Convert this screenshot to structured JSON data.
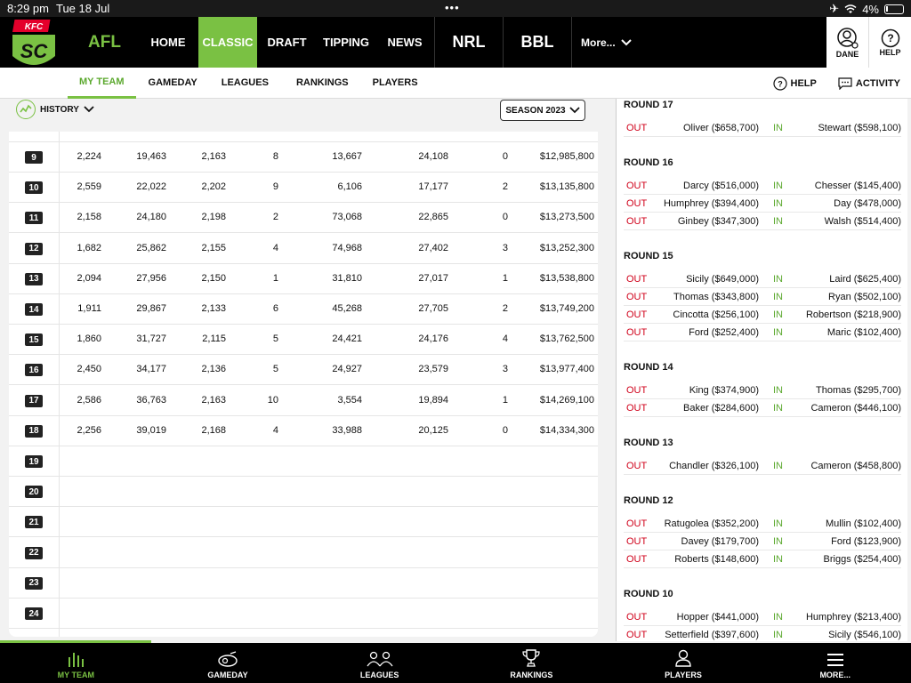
{
  "status": {
    "time": "8:29 pm",
    "date": "Tue 18 Jul",
    "battery": "4%"
  },
  "topnav": {
    "logo_text": "KFC",
    "logo_mark": "SC",
    "afl": "AFL",
    "links": [
      "HOME",
      "CLASSIC",
      "DRAFT",
      "TIPPING",
      "NEWS"
    ],
    "active_link": "CLASSIC",
    "nrl": "NRL",
    "bbl": "BBL",
    "more": "More...",
    "user": "DANE",
    "help": "HELP"
  },
  "subnav": {
    "tabs": [
      "MY TEAM",
      "GAMEDAY",
      "LEAGUES",
      "RANKINGS",
      "PLAYERS"
    ],
    "active": "MY TEAM",
    "help": "HELP",
    "activity": "ACTIVITY"
  },
  "history": {
    "label": "HISTORY",
    "season": "SEASON 2023"
  },
  "table": {
    "rows": [
      {
        "round": "9",
        "cells": [
          "2,224",
          "19,463",
          "2,163",
          "8",
          "13,667",
          "24,108",
          "0",
          "$12,985,800"
        ]
      },
      {
        "round": "10",
        "cells": [
          "2,559",
          "22,022",
          "2,202",
          "9",
          "6,106",
          "17,177",
          "2",
          "$13,135,800"
        ]
      },
      {
        "round": "11",
        "cells": [
          "2,158",
          "24,180",
          "2,198",
          "2",
          "73,068",
          "22,865",
          "0",
          "$13,273,500"
        ]
      },
      {
        "round": "12",
        "cells": [
          "1,682",
          "25,862",
          "2,155",
          "4",
          "74,968",
          "27,402",
          "3",
          "$13,252,300"
        ]
      },
      {
        "round": "13",
        "cells": [
          "2,094",
          "27,956",
          "2,150",
          "1",
          "31,810",
          "27,017",
          "1",
          "$13,538,800"
        ]
      },
      {
        "round": "14",
        "cells": [
          "1,911",
          "29,867",
          "2,133",
          "6",
          "45,268",
          "27,705",
          "2",
          "$13,749,200"
        ]
      },
      {
        "round": "15",
        "cells": [
          "1,860",
          "31,727",
          "2,115",
          "5",
          "24,421",
          "24,176",
          "4",
          "$13,762,500"
        ]
      },
      {
        "round": "16",
        "cells": [
          "2,450",
          "34,177",
          "2,136",
          "5",
          "24,927",
          "23,579",
          "3",
          "$13,977,400"
        ]
      },
      {
        "round": "17",
        "cells": [
          "2,586",
          "36,763",
          "2,163",
          "10",
          "3,554",
          "19,894",
          "1",
          "$14,269,100"
        ]
      },
      {
        "round": "18",
        "cells": [
          "2,256",
          "39,019",
          "2,168",
          "4",
          "33,988",
          "20,125",
          "0",
          "$14,334,300"
        ]
      },
      {
        "round": "19",
        "cells": []
      },
      {
        "round": "20",
        "cells": []
      },
      {
        "round": "21",
        "cells": []
      },
      {
        "round": "22",
        "cells": []
      },
      {
        "round": "23",
        "cells": []
      },
      {
        "round": "24",
        "cells": []
      }
    ]
  },
  "trades": {
    "out_label": "OUT",
    "in_label": "IN",
    "rounds": [
      {
        "title": "ROUND 17",
        "trades": [
          [
            "Oliver ($658,700)",
            "Stewart ($598,100)"
          ]
        ]
      },
      {
        "title": "ROUND 16",
        "trades": [
          [
            "Darcy ($516,000)",
            "Chesser ($145,400)"
          ],
          [
            "Humphrey ($394,400)",
            "Day ($478,000)"
          ],
          [
            "Ginbey ($347,300)",
            "Walsh ($514,400)"
          ]
        ]
      },
      {
        "title": "ROUND 15",
        "trades": [
          [
            "Sicily ($649,000)",
            "Laird ($625,400)"
          ],
          [
            "Thomas ($343,800)",
            "Ryan ($502,100)"
          ],
          [
            "Cincotta ($256,100)",
            "Robertson ($218,900)"
          ],
          [
            "Ford ($252,400)",
            "Maric ($102,400)"
          ]
        ]
      },
      {
        "title": "ROUND 14",
        "trades": [
          [
            "King ($374,900)",
            "Thomas ($295,700)"
          ],
          [
            "Baker ($284,600)",
            "Cameron ($446,100)"
          ]
        ]
      },
      {
        "title": "ROUND 13",
        "trades": [
          [
            "Chandler ($326,100)",
            "Cameron ($458,800)"
          ]
        ]
      },
      {
        "title": "ROUND 12",
        "trades": [
          [
            "Ratugolea ($352,200)",
            "Mullin ($102,400)"
          ],
          [
            "Davey ($179,700)",
            "Ford ($123,900)"
          ],
          [
            "Roberts ($148,600)",
            "Briggs ($254,400)"
          ]
        ]
      },
      {
        "title": "ROUND 10",
        "trades": [
          [
            "Hopper ($441,000)",
            "Humphrey ($213,400)"
          ],
          [
            "Setterfield ($397,600)",
            "Sicily ($546,100)"
          ]
        ]
      }
    ]
  },
  "tabbar": {
    "tabs": [
      {
        "label": "MY TEAM",
        "icon": "bar-chart-icon"
      },
      {
        "label": "GAMEDAY",
        "icon": "whistle-icon"
      },
      {
        "label": "LEAGUES",
        "icon": "versus-icon"
      },
      {
        "label": "RANKINGS",
        "icon": "trophy-icon"
      },
      {
        "label": "PLAYERS",
        "icon": "person-icon"
      },
      {
        "label": "MORE...",
        "icon": "menu-icon"
      }
    ],
    "active": "MY TEAM"
  },
  "colors": {
    "accent": "#7ac143",
    "out": "#d0021b",
    "in": "#5ca92f",
    "brand_red": "#e4002b"
  }
}
